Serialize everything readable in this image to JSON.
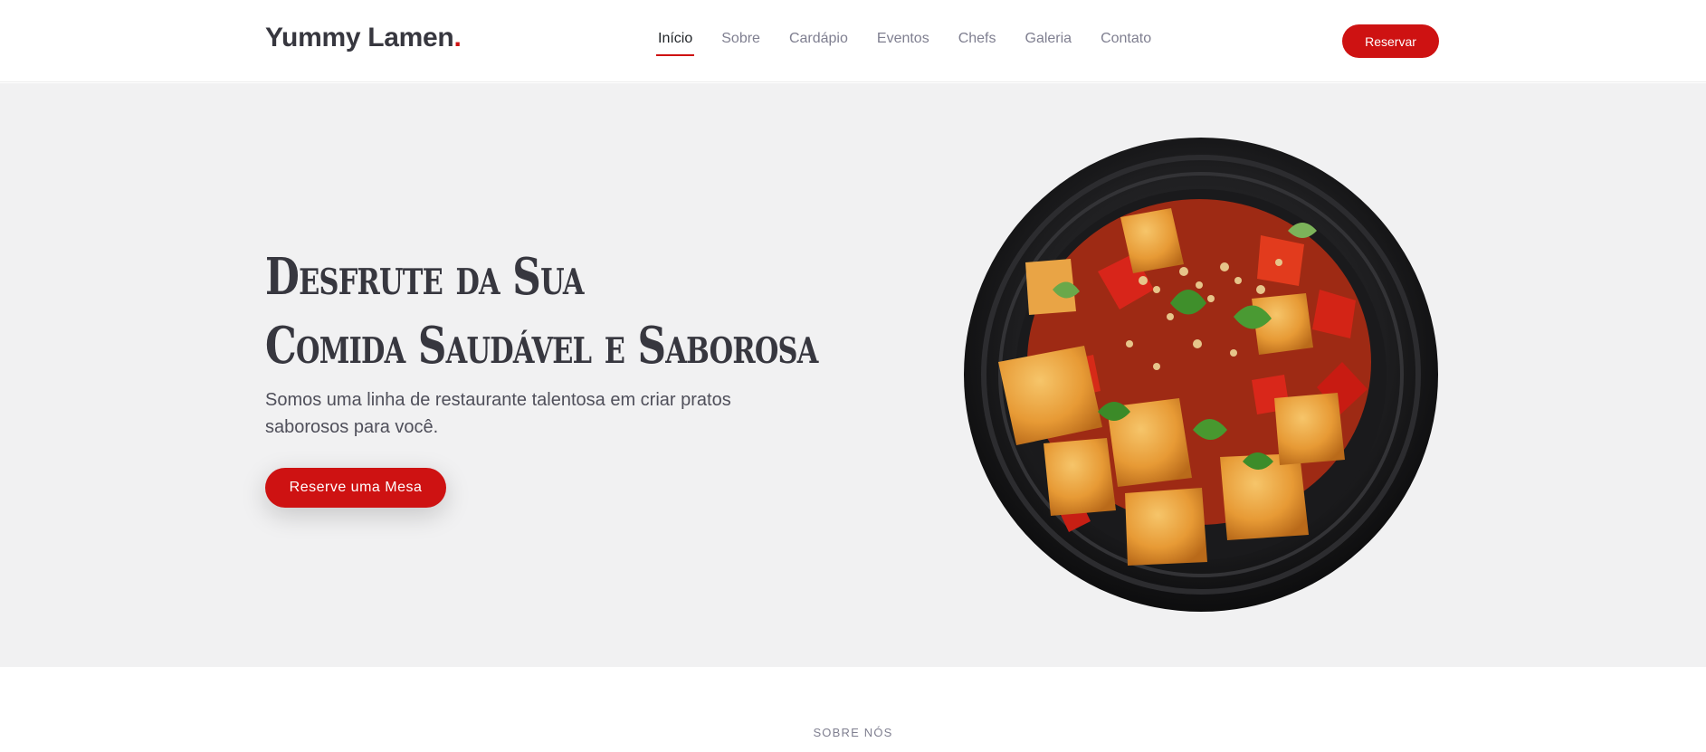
{
  "brand": {
    "name": "Yummy Lamen",
    "dot": ".",
    "accent": "#ce1212"
  },
  "nav": {
    "items": [
      {
        "label": "Início",
        "active": true
      },
      {
        "label": "Sobre",
        "active": false
      },
      {
        "label": "Cardápio",
        "active": false
      },
      {
        "label": "Eventos",
        "active": false
      },
      {
        "label": "Chefs",
        "active": false
      },
      {
        "label": "Galeria",
        "active": false
      },
      {
        "label": "Contato",
        "active": false
      }
    ],
    "cta_label": "Reservar"
  },
  "hero": {
    "title_line1": "Desfrute da Sua",
    "title_line2": "Comida Saudável e Saborosa",
    "subtitle": "Somos uma linha de restaurante talentosa em criar pratos saborosos para você.",
    "cta_label": "Reserve uma Mesa",
    "image": "food-bowl-image"
  },
  "about": {
    "section_label": "SOBRE NÓS"
  },
  "colors": {
    "accent": "#ce1212",
    "hero_bg": "#f1f1f2",
    "text_dark": "#37373f",
    "text_muted": "#7f7f90"
  }
}
